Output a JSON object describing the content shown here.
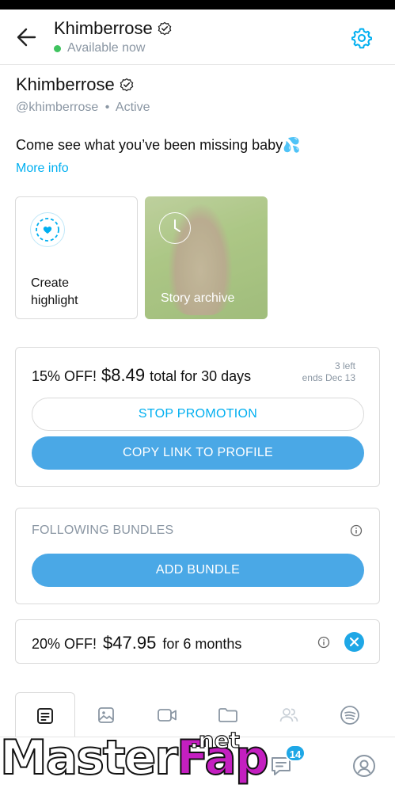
{
  "header": {
    "name": "Khimberrose",
    "status": "Available now"
  },
  "profile": {
    "name": "Khimberrose",
    "handle": "@khimberrose",
    "separator": "•",
    "activity": "Active",
    "bio": "Come see what you’ve been missing baby💦",
    "more_info": "More info"
  },
  "highlights": {
    "create_label": "Create highlight",
    "archive_label": "Story archive"
  },
  "promotion": {
    "discount": "15% OFF!",
    "price": "$8.49",
    "suffix": "total for 30 days",
    "left": "3 left",
    "ends": "ends Dec 13",
    "stop_label": "STOP PROMOTION",
    "copy_label": "COPY LINK TO PROFILE"
  },
  "bundles": {
    "title": "FOLLOWING BUNDLES",
    "add_label": "ADD BUNDLE",
    "item": {
      "discount": "20% OFF!",
      "price": "$47.95",
      "suffix": "for 6 months"
    }
  },
  "tabs": [
    "posts-icon",
    "photos-icon",
    "videos-icon",
    "folder-icon",
    "users-icon",
    "spotify-icon"
  ],
  "bottom_nav": {
    "messages_badge": "14"
  },
  "watermark": {
    "part1": "Master",
    "part2": "Fap",
    "suffix": ".net"
  },
  "colors": {
    "accent": "#00aff0",
    "button": "#4aa8e6",
    "online": "#3fc35f",
    "muted": "#8a96a3"
  }
}
